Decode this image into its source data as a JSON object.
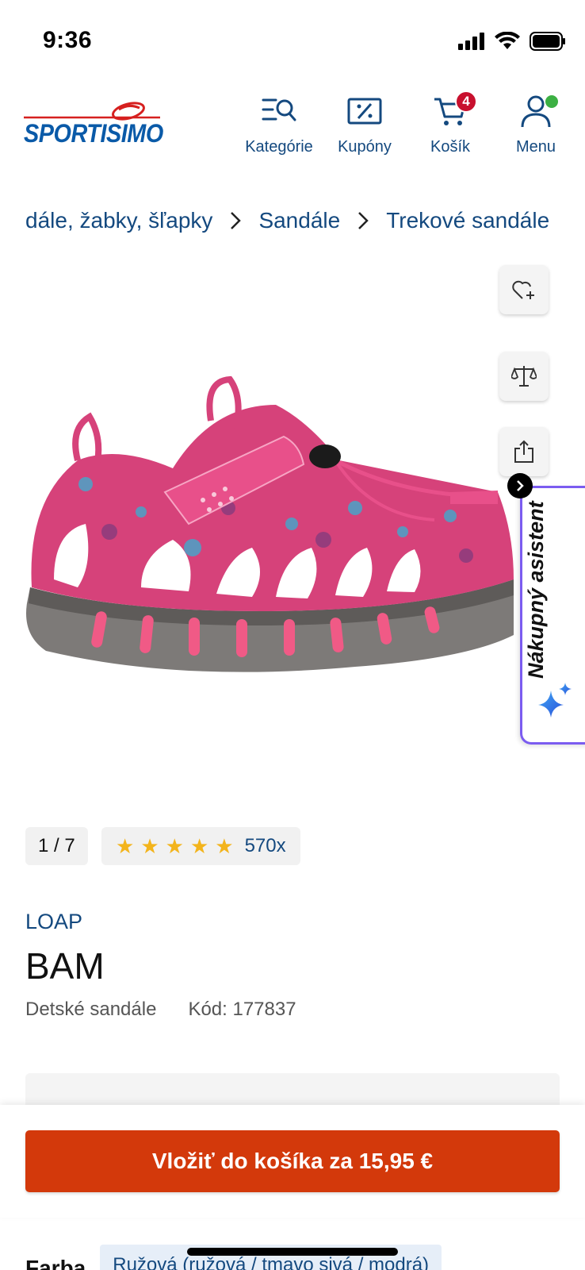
{
  "status_bar": {
    "time": "9:36"
  },
  "header": {
    "logo_text": "SPORTISIMO",
    "nav": [
      {
        "label": "Kategórie",
        "icon": "categories-search-icon"
      },
      {
        "label": "Kupóny",
        "icon": "coupon-percent-icon"
      },
      {
        "label": "Košík",
        "icon": "cart-icon",
        "badge": "4"
      },
      {
        "label": "Menu",
        "icon": "user-icon"
      }
    ]
  },
  "breadcrumb": [
    "dále, žabky, šľapky",
    "Sandále",
    "Trekové sandále"
  ],
  "assistant": {
    "label": "Nákupný asistent"
  },
  "gallery": {
    "counter": "1 / 7"
  },
  "rating": {
    "stars": 5,
    "count": "570x"
  },
  "product": {
    "brand": "LOAP",
    "name": "BAM",
    "category": "Detské sandále",
    "code": "Kód: 177837"
  },
  "cart_button": {
    "label": "Vložiť do košíka za 15,95 €"
  },
  "color": {
    "label": "Farba",
    "value": "Ružová (ružová / tmavo sivá / modrá)"
  },
  "colors": {
    "primary": "#14497f",
    "accent": "#d3390b",
    "badge": "#c8102e",
    "assistant_border": "#7b5cf0"
  }
}
